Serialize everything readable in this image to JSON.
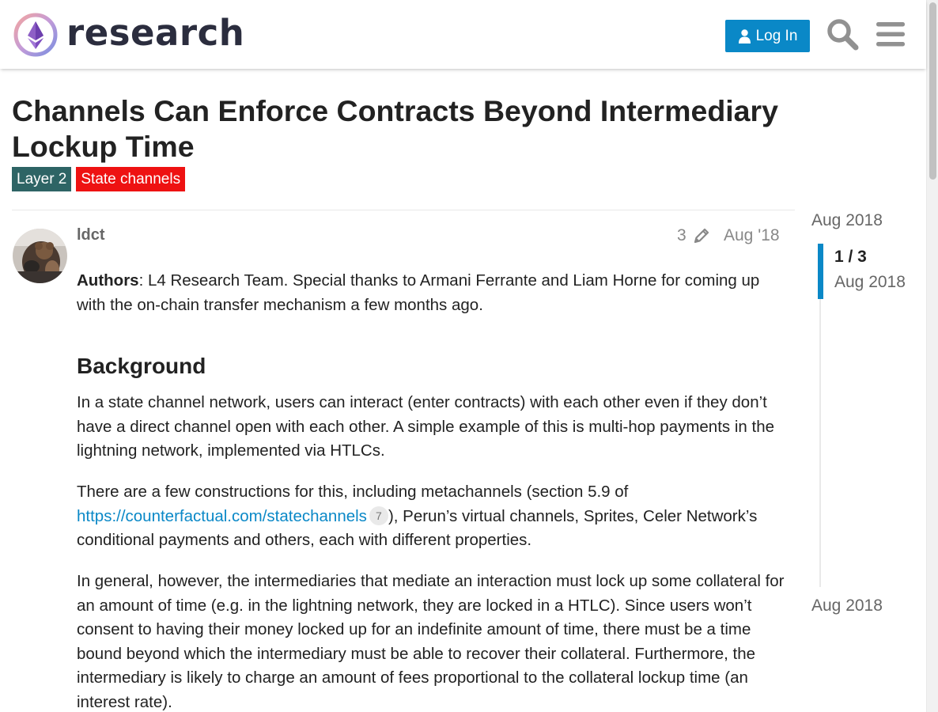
{
  "header": {
    "logo_text": "research",
    "login_label": "Log In"
  },
  "topic": {
    "title": "Channels Can Enforce Contracts Beyond Intermediary Lockup Time",
    "tags": [
      "Layer 2",
      "State channels"
    ]
  },
  "post": {
    "username": "ldct",
    "edit_count": "3",
    "date": "Aug '18",
    "authors_label": "Authors",
    "authors_text": ": L4 Research Team. Special thanks to Armani Ferrante and Liam Horne for coming up with the on-chain transfer mechanism a few months ago.",
    "heading": "Background",
    "para1": "In a state channel network, users can interact (enter contracts) with each other even if they don’t have a direct channel open with each other. A simple example of this is multi-hop payments in the lightning network, implemented via HTLCs.",
    "para2_before": "There are a few constructions for this, including metachannels (section 5.9 of ",
    "para2_link": "https://counterfactual.com/statechannels",
    "para2_link_clicks": "7",
    "para2_after": "), Perun’s virtual channels, Sprites, Celer Network’s conditional payments and others, each with different properties.",
    "para3": "In general, however, the intermediaries that mediate an interaction must lock up some collateral for an amount of time (e.g. in the lightning network, they are locked in a HTLC). Since users won’t consent to having their money locked up for an indefinite amount of time, there must be a time bound beyond which the intermediary must be able to recover their collateral. Furthermore, the intermediary is likely to charge an amount of fees proportional to the collateral lockup time (an interest rate)."
  },
  "timeline": {
    "start_date": "Aug 2018",
    "position": "1 / 3",
    "position_date": "Aug 2018",
    "end_date": "Aug 2018"
  },
  "colors": {
    "accent": "#0a88c7",
    "tag_layer2": "#2e6465",
    "tag_state_channels": "#ee1212"
  }
}
